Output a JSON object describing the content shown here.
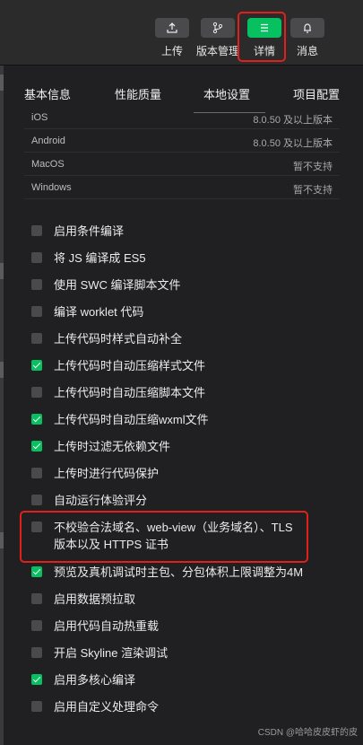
{
  "toolbar": {
    "buttons": [
      {
        "label": "上传",
        "icon": "upload-icon"
      },
      {
        "label": "版本管理",
        "icon": "branch-icon"
      },
      {
        "label": "详情",
        "icon": "menu-icon",
        "active": true
      },
      {
        "label": "消息",
        "icon": "bell-icon"
      }
    ]
  },
  "tabs": [
    "基本信息",
    "性能质量",
    "本地设置",
    "项目配置"
  ],
  "libraries": [
    {
      "platform": "iOS",
      "requirement": "8.0.50 及以上版本"
    },
    {
      "platform": "Android",
      "requirement": "8.0.50 及以上版本"
    },
    {
      "platform": "MacOS",
      "requirement": "暂不支持"
    },
    {
      "platform": "Windows",
      "requirement": "暂不支持"
    }
  ],
  "options": [
    {
      "label": "启用条件编译",
      "checked": false
    },
    {
      "label": "将 JS 编译成 ES5",
      "checked": false
    },
    {
      "label": "使用 SWC 编译脚本文件",
      "checked": false
    },
    {
      "label": "编译 worklet 代码",
      "checked": false
    },
    {
      "label": "上传代码时样式自动补全",
      "checked": false
    },
    {
      "label": "上传代码时自动压缩样式文件",
      "checked": true
    },
    {
      "label": "上传代码时自动压缩脚本文件",
      "checked": false
    },
    {
      "label": "上传代码时自动压缩wxml文件",
      "checked": true
    },
    {
      "label": "上传时过滤无依赖文件",
      "checked": true
    },
    {
      "label": "上传时进行代码保护",
      "checked": false
    },
    {
      "label": "自动运行体验评分",
      "checked": false
    },
    {
      "label": "不校验合法域名、web-view（业务域名）、TLS 版本以及 HTTPS 证书",
      "checked": false
    },
    {
      "label": "预览及真机调试时主包、分包体积上限调整为4M",
      "checked": true
    },
    {
      "label": "启用数据预拉取",
      "checked": false
    },
    {
      "label": "启用代码自动热重载",
      "checked": false
    },
    {
      "label": "开启 Skyline 渲染调试",
      "checked": false
    },
    {
      "label": "启用多核心编译",
      "checked": true
    },
    {
      "label": "启用自定义处理命令",
      "checked": false
    }
  ],
  "watermark": "CSDN @哈哈皮皮虾的皮",
  "colors": {
    "accent": "#07c160",
    "highlight": "#e0201a",
    "panel": "#202022"
  }
}
